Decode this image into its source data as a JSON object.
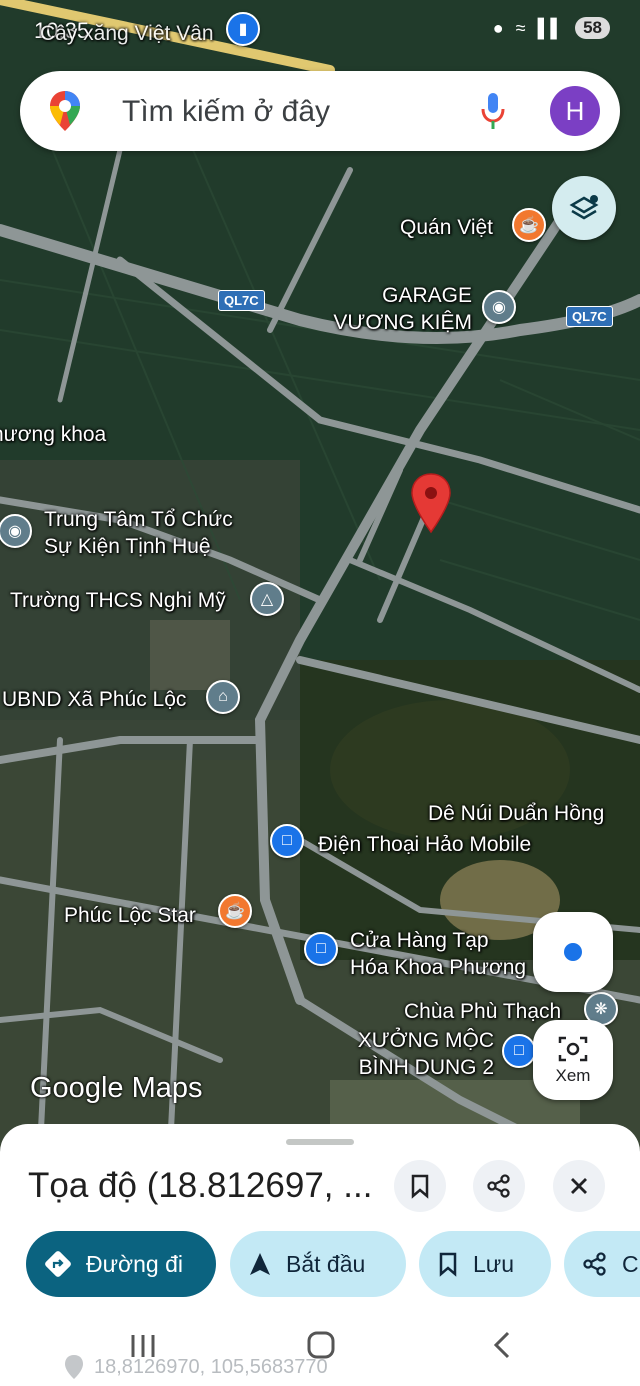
{
  "status_bar": {
    "time": "10:35",
    "battery": "58"
  },
  "search": {
    "placeholder": "Tìm kiếm ở đây",
    "avatar_letter": "H"
  },
  "map": {
    "top_label": "Cây xăng Việt Vân",
    "route_badges": [
      "QL7C",
      "QL7C"
    ],
    "places": [
      {
        "name": "Quán Việt"
      },
      {
        "name": "GARAGE\nVƯƠNG KIỆM"
      },
      {
        "name": "hương khoa"
      },
      {
        "name": "Trung Tâm Tổ Chức\nSự Kiện Tịnh Huệ"
      },
      {
        "name": "Trường THCS Nghi Mỹ"
      },
      {
        "name": "UBND Xã Phúc Lộc"
      },
      {
        "name": "Dê Núi Duẩn Hồng"
      },
      {
        "name": "Điện Thoại Hảo Mobile"
      },
      {
        "name": "Phúc Lộc Star"
      },
      {
        "name": "Cửa Hàng Tạp\nHóa Khoa Phương"
      },
      {
        "name": "Chùa Phù Thạch"
      },
      {
        "name": "XƯỞNG MỘC\nBÌNH DUNG 2"
      }
    ],
    "logo": "Google Maps",
    "lens_label": "Xem"
  },
  "sheet": {
    "title": "Tọa độ (18.812697, ...",
    "actions": [
      {
        "label": "Đường đi",
        "icon": "directions-icon"
      },
      {
        "label": "Bắt đầu",
        "icon": "navigation-arrow-icon"
      },
      {
        "label": "Lưu",
        "icon": "bookmark-icon"
      },
      {
        "label": "C",
        "icon": "share-icon"
      }
    ],
    "faded_coords": "18,8126970, 105,5683770"
  },
  "colors": {
    "accent": "#0b6380",
    "chip": "#c3e9f5",
    "pin": "#e53935",
    "shop": "#1a73e8",
    "cafe": "#f2782f",
    "place": "#607d8b"
  }
}
